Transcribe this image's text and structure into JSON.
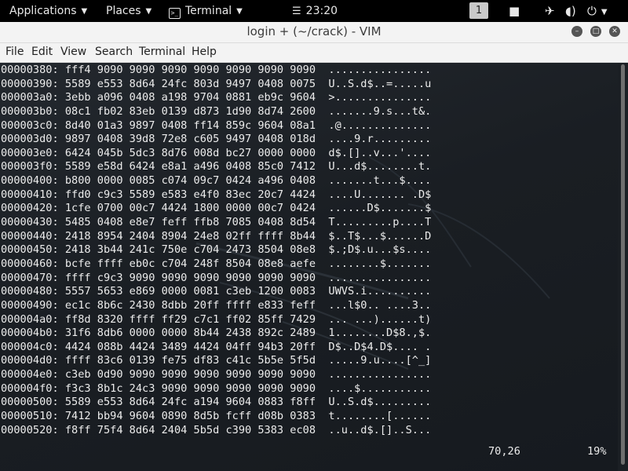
{
  "topbar": {
    "applications": "Applications",
    "places": "Places",
    "terminal": "Terminal",
    "clock": "23:20",
    "workspace": "1"
  },
  "window": {
    "title": "login + (~/crack) - VIM"
  },
  "menu": [
    "File",
    "Edit",
    "View",
    "Search",
    "Terminal",
    "Help"
  ],
  "hexdump": [
    "00000380: fff4 9090 9090 9090 9090 9090 9090 9090  ................",
    "00000390: 5589 e553 8d64 24fc 803d 9497 0408 0075  U..S.d$..=.....u",
    "000003a0: 3ebb a096 0408 a198 9704 0881 eb9c 9604  >...............",
    "000003b0: 08c1 fb02 83eb 0139 d873 1d90 8d74 2600  .......9.s...t&.",
    "000003c0: 8d40 01a3 9897 0408 ff14 859c 9604 08a1  .@..............",
    "000003d0: 9897 0408 39d8 72e8 c605 9497 0408 018d  ....9.r.........",
    "000003e0: 6424 045b 5dc3 8d76 008d bc27 0000 0000  d$.[]..v...'....",
    "000003f0: 5589 e58d 6424 e8a1 a496 0408 85c0 7412  U...d$........t.",
    "00000400: b800 0000 0085 c074 09c7 0424 a496 0408  .......t...$....",
    "00000410: ffd0 c9c3 5589 e583 e4f0 83ec 20c7 4424  ....U....... .D$",
    "00000420: 1cfe 0700 00c7 4424 1800 0000 00c7 0424  ......D$.......$",
    "00000430: 5485 0408 e8e7 feff ffb8 7085 0408 8d54  T.........p....T",
    "00000440: 2418 8954 2404 8904 24e8 02ff ffff 8b44  $..T$...$......D",
    "00000450: 2418 3b44 241c 750e c704 2473 8504 08e8  $.;D$.u...$s....",
    "00000460: bcfe ffff eb0c c704 248f 8504 08e8 aefe  ........$.......",
    "00000470: ffff c9c3 9090 9090 9090 9090 9090 9090  ................",
    "00000480: 5557 5653 e869 0000 0081 c3eb 1200 0083  UWVS.i..........",
    "00000490: ec1c 8b6c 2430 8dbb 20ff ffff e833 feff  ...l$0.. ....3..",
    "000004a0: ff8d 8320 ffff ff29 c7c1 ff02 85ff 7429  ... ...)......t)",
    "000004b0: 31f6 8db6 0000 0000 8b44 2438 892c 2489  1........D$8.,$.",
    "000004c0: 4424 088b 4424 3489 4424 04ff 94b3 20ff  D$..D$4.D$.... .",
    "000004d0: ffff 83c6 0139 fe75 df83 c41c 5b5e 5f5d  .....9.u....[^_]",
    "000004e0: c3eb 0d90 9090 9090 9090 9090 9090 9090  ................",
    "000004f0: f3c3 8b1c 24c3 9090 9090 9090 9090 9090  ....$...........",
    "00000500: 5589 e553 8d64 24fc a194 9604 0883 f8ff  U..S.d$.........",
    "00000510: 7412 bb94 9604 0890 8d5b fcff d08b 0383  t........[......",
    "00000520: f8ff 75f4 8d64 2404 5b5d c390 5383 ec08  ..u..d$.[]..S..."
  ],
  "status": {
    "position": "70,26",
    "percent": "19%"
  }
}
